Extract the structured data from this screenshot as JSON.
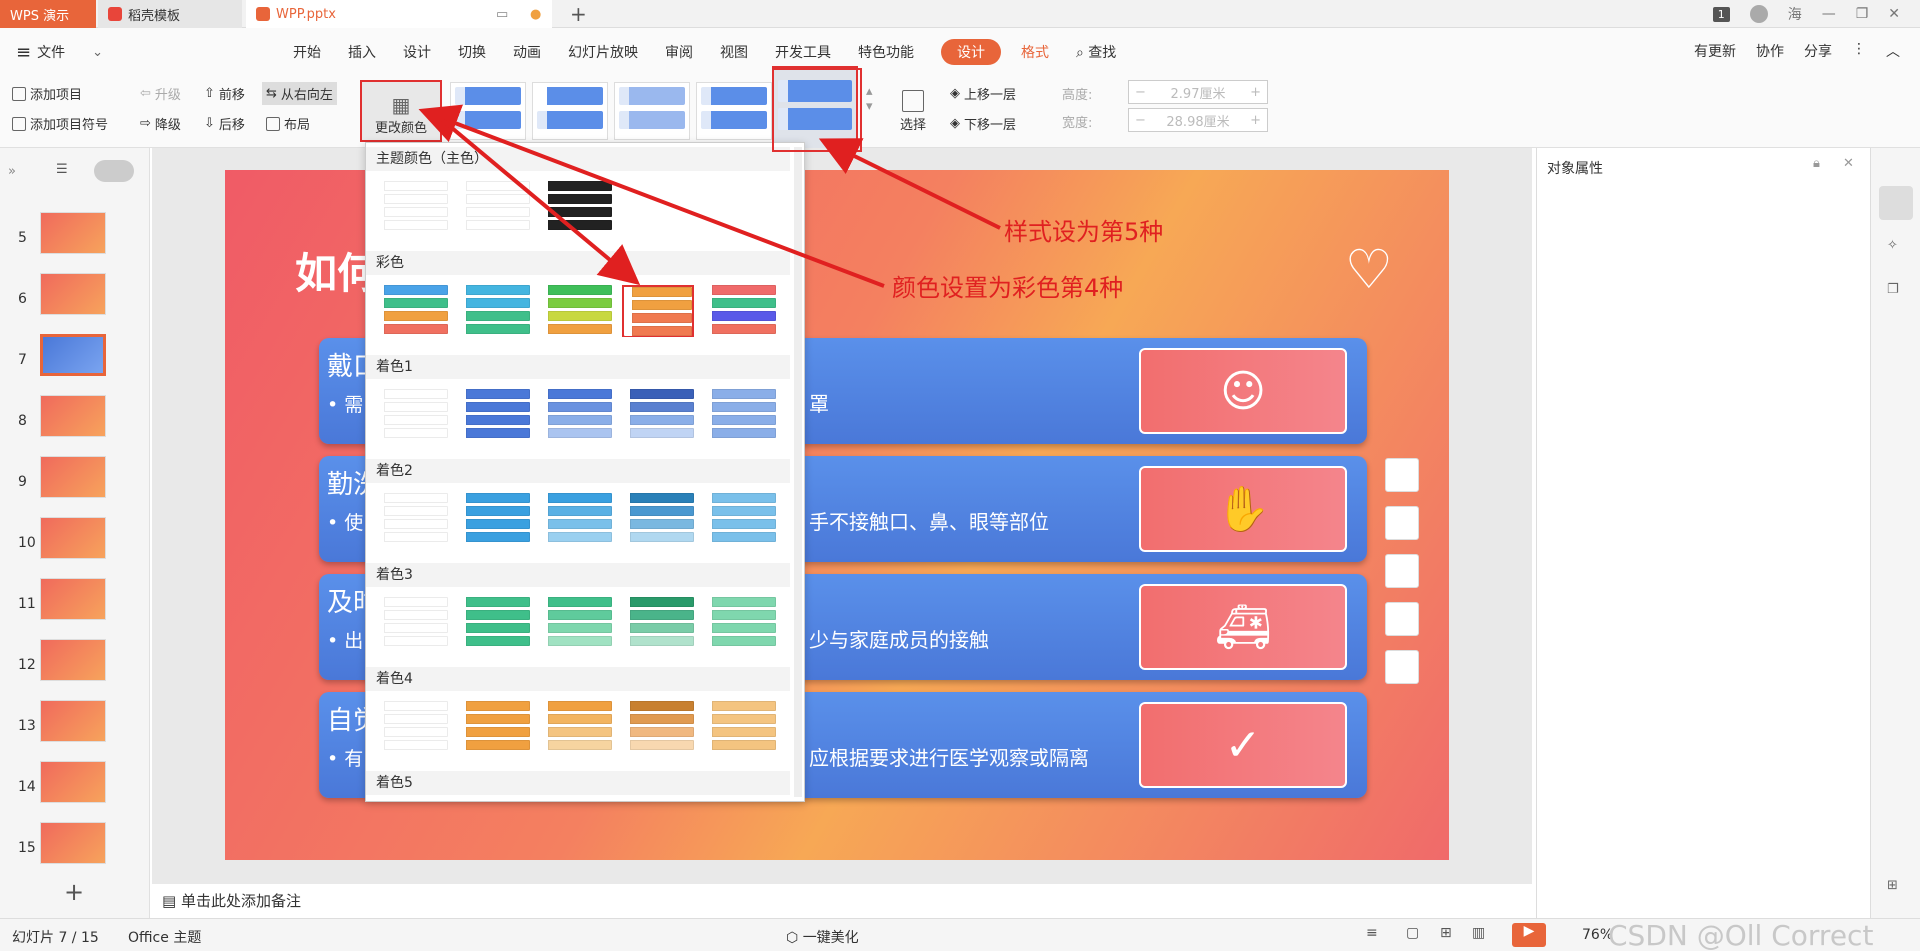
{
  "tabs": {
    "app": "WPS 演示",
    "template": "稻壳模板",
    "file": "WPP.pptx",
    "page_count_badge": "1",
    "user": "海"
  },
  "menu": {
    "file": "文件",
    "items": [
      "开始",
      "插入",
      "设计",
      "切换",
      "动画",
      "幻灯片放映",
      "审阅",
      "视图",
      "开发工具",
      "特色功能"
    ],
    "design": "设计",
    "format": "格式",
    "find": "查找",
    "update": "有更新",
    "collab": "协作",
    "share": "分享"
  },
  "ribbon": {
    "add_item": "添加项目",
    "add_symbol": "添加项目符号",
    "promote": "升级",
    "demote": "降级",
    "forward": "前移",
    "backward": "后移",
    "rtl": "从右向左",
    "layout": "布局",
    "change_color": "更改颜色",
    "select": "选择",
    "up_layer": "上移一层",
    "down_layer": "下移一层",
    "height_label": "高度:",
    "height_value": "2.97厘米",
    "width_label": "宽度:",
    "width_value": "28.98厘米"
  },
  "slides": [
    "5",
    "6",
    "7",
    "8",
    "9",
    "10",
    "11",
    "12",
    "13",
    "14",
    "15"
  ],
  "slide": {
    "title": "如何",
    "rows": [
      {
        "head": "戴口",
        "text": "罩",
        "bullet": "• 需"
      },
      {
        "head": "勤洗",
        "text": "手不接触口、鼻、眼等部位",
        "bullet": "• 使"
      },
      {
        "head": "及时",
        "text": "少与家庭成员的接触",
        "bullet": "• 出"
      },
      {
        "head": "自觉",
        "text": "应根据要求进行医学观察或隔离",
        "bullet": "• 有"
      }
    ]
  },
  "dropdown": {
    "theme": "主题颜色（主色）",
    "colorful": "彩色",
    "accent1": "着色1",
    "accent2": "着色2",
    "accent3": "着色3",
    "accent4": "着色4",
    "accent5": "着色5"
  },
  "annotations": {
    "style": "样式设为第5种",
    "color": "颜色设置为彩色第4种"
  },
  "right": {
    "title": "对象属性"
  },
  "notes": "单击此处添加备注",
  "status": {
    "slide": "幻灯片 7 / 15",
    "theme": "Office 主题",
    "beautify": "一键美化",
    "zoom": "76%",
    "watermark": "CSDN @Oll Correct"
  },
  "colors": {
    "accent": "#e8653a",
    "annotation": "#e02020"
  }
}
